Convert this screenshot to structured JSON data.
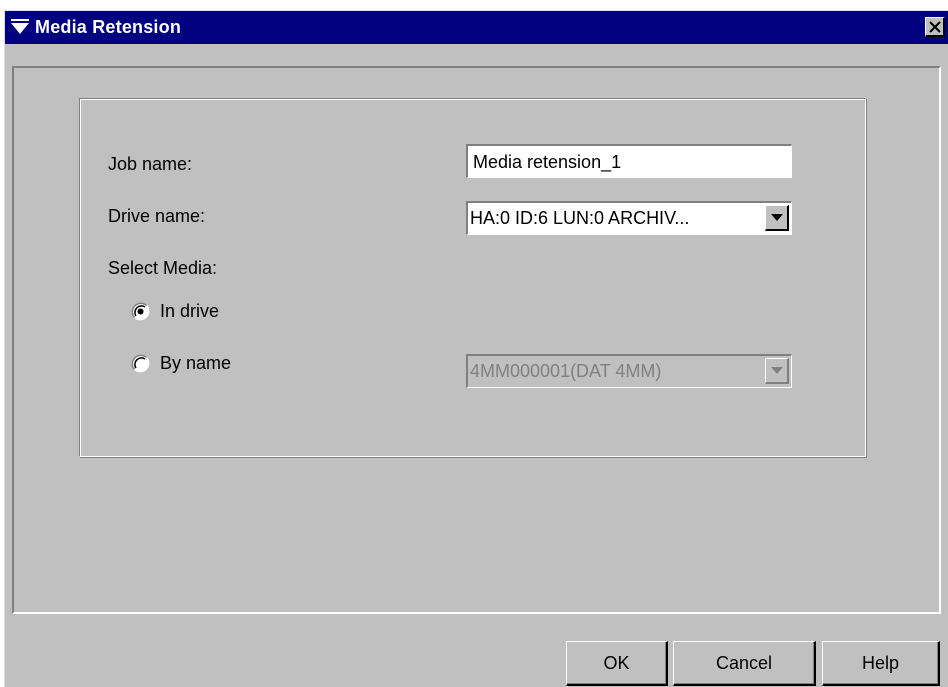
{
  "window": {
    "title": "Media Retension",
    "title_icon": "funnel-icon",
    "close_icon": "close-icon"
  },
  "form": {
    "job_name_label": "Job name:",
    "job_name_value": "Media retension_1",
    "drive_name_label": "Drive name:",
    "drive_name_value": "HA:0 ID:6 LUN:0 ARCHIV...",
    "select_media_label": "Select Media:",
    "in_drive_label": "In drive",
    "in_drive_selected": true,
    "by_name_label": "By name",
    "by_name_selected": false,
    "media_value": "4MM000001(DAT 4MM)",
    "media_enabled": false
  },
  "buttons": {
    "ok": "OK",
    "cancel": "Cancel",
    "help": "Help"
  },
  "colors": {
    "titlebar": "#000080",
    "face": "#c0c0c0",
    "disabled_text": "#808080"
  }
}
